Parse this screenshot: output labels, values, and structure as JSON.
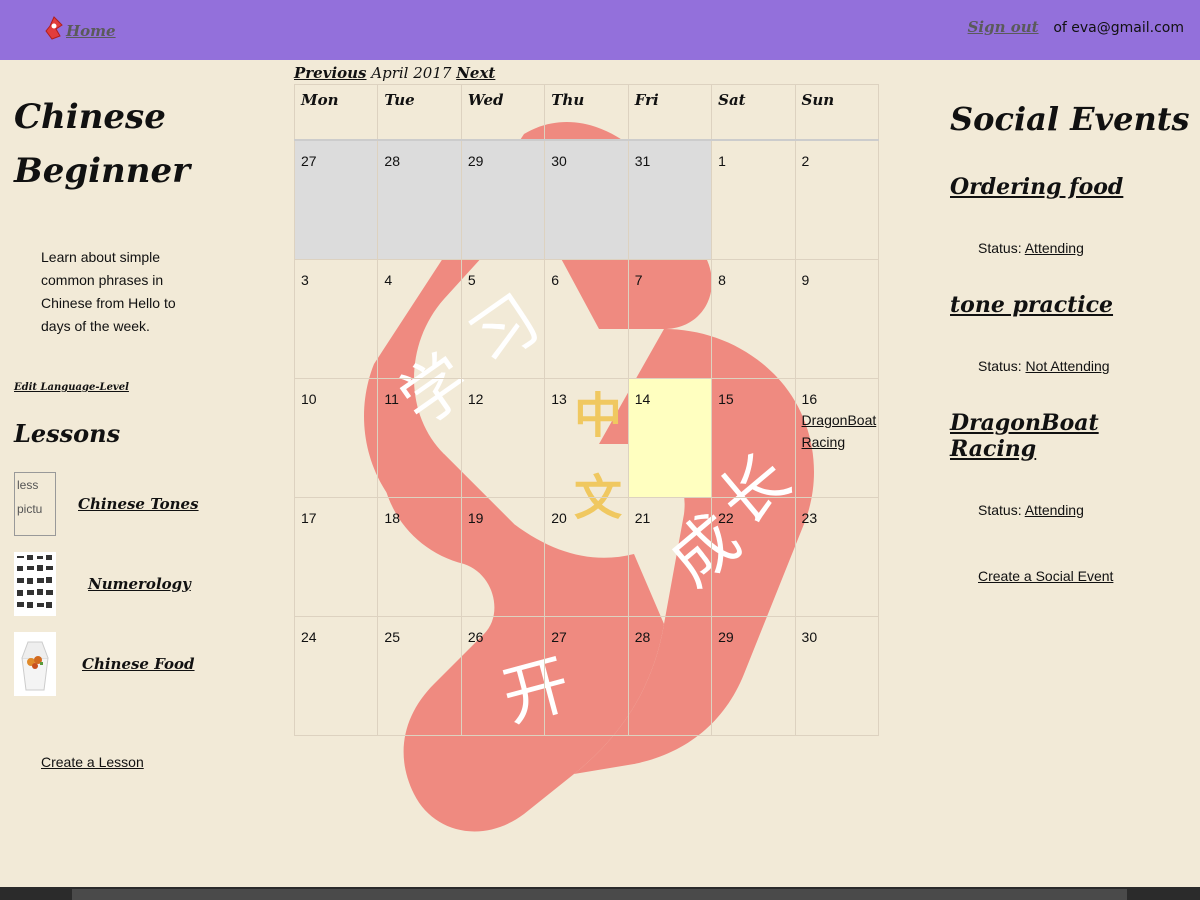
{
  "nav": {
    "home_label": "Home",
    "signout_label": "Sign out",
    "user_text": "of eva@gmail.com",
    "bar_color": "#9370db"
  },
  "course": {
    "title_line1": "Chinese",
    "title_line2": "Beginner",
    "description": "Learn about simple common phrases in Chinese from Hello to days of the week.",
    "edit_label": "Edit Language-Level"
  },
  "lessons": {
    "heading": "Lessons",
    "items": [
      {
        "label": "Chinese Tones",
        "thumb_alt": "less pictu"
      },
      {
        "label": "Numerology"
      },
      {
        "label": "Chinese Food"
      }
    ],
    "create_label": "Create a Lesson"
  },
  "calendar": {
    "prev_label": "Previous",
    "month_label": "April 2017",
    "next_label": "Next",
    "weekdays": [
      "Mon",
      "Tue",
      "Wed",
      "Thu",
      "Fri",
      "Sat",
      "Sun"
    ],
    "weeks": [
      [
        "27",
        "28",
        "29",
        "30",
        "31",
        "1",
        "2"
      ],
      [
        "3",
        "4",
        "5",
        "6",
        "7",
        "8",
        "9"
      ],
      [
        "10",
        "11",
        "12",
        "13",
        "14",
        "15",
        "16"
      ],
      [
        "17",
        "18",
        "19",
        "20",
        "21",
        "22",
        "23"
      ],
      [
        "24",
        "25",
        "26",
        "27",
        "28",
        "29",
        "30"
      ]
    ],
    "event_day_16": "DragonBoat Racing",
    "watermark_chars": [
      "学",
      "习",
      "中",
      "文",
      "成",
      "长",
      "开"
    ]
  },
  "social": {
    "heading": "Social Events",
    "status_prefix": "Status:",
    "events": [
      {
        "title": "Ordering food",
        "status": "Attending"
      },
      {
        "title": "tone practice",
        "status": "Not Attending"
      },
      {
        "title": "DragonBoat Racing",
        "status": "Attending"
      }
    ],
    "create_label": "Create a Social Event"
  }
}
